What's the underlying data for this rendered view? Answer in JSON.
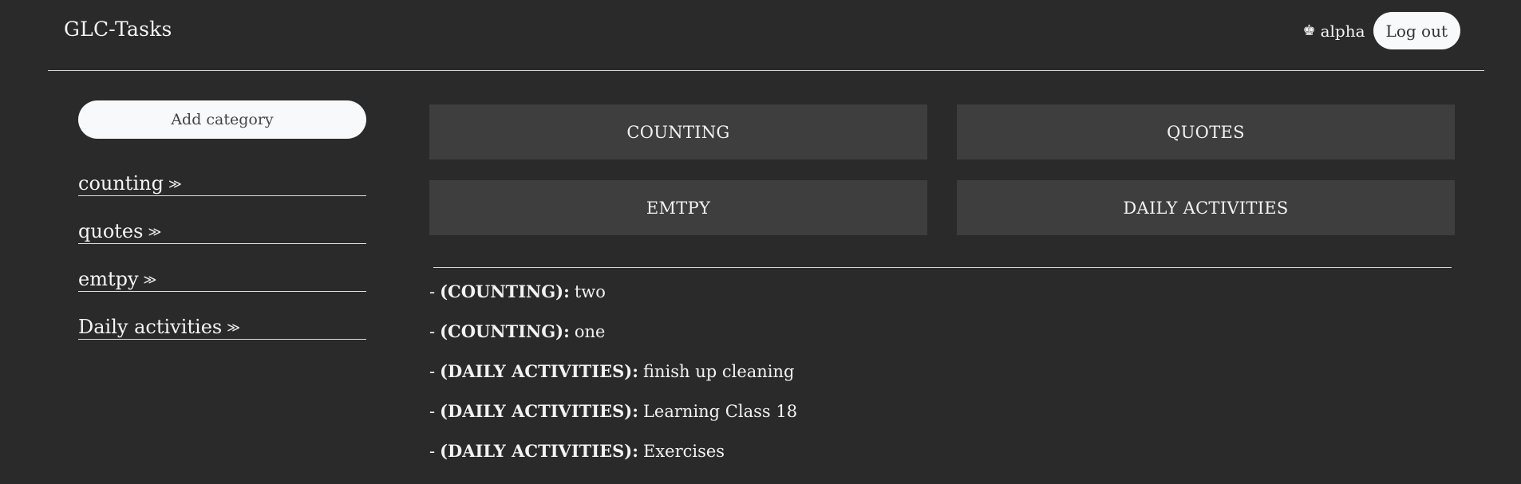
{
  "header": {
    "brand": "GLC-Tasks",
    "user_icon": "♚",
    "username": "alpha",
    "logout_label": "Log out"
  },
  "sidebar": {
    "add_category_label": "Add category",
    "categories": [
      {
        "label": "counting",
        "chevron": "≫"
      },
      {
        "label": "quotes",
        "chevron": "≫"
      },
      {
        "label": "emtpy",
        "chevron": "≫"
      },
      {
        "label": "Daily activities",
        "chevron": "≫"
      }
    ]
  },
  "main": {
    "tiles": [
      "COUNTING",
      "QUOTES",
      "EMTPY",
      "DAILY ACTIVITIES"
    ],
    "tasks": [
      {
        "dash": "-",
        "category": "(COUNTING):",
        "text": "two"
      },
      {
        "dash": "-",
        "category": "(COUNTING):",
        "text": "one"
      },
      {
        "dash": "-",
        "category": "(DAILY ACTIVITIES):",
        "text": "finish up cleaning"
      },
      {
        "dash": "-",
        "category": "(DAILY ACTIVITIES):",
        "text": "Learning Class 18"
      },
      {
        "dash": "-",
        "category": "(DAILY ACTIVITIES):",
        "text": "Exercises"
      }
    ]
  }
}
